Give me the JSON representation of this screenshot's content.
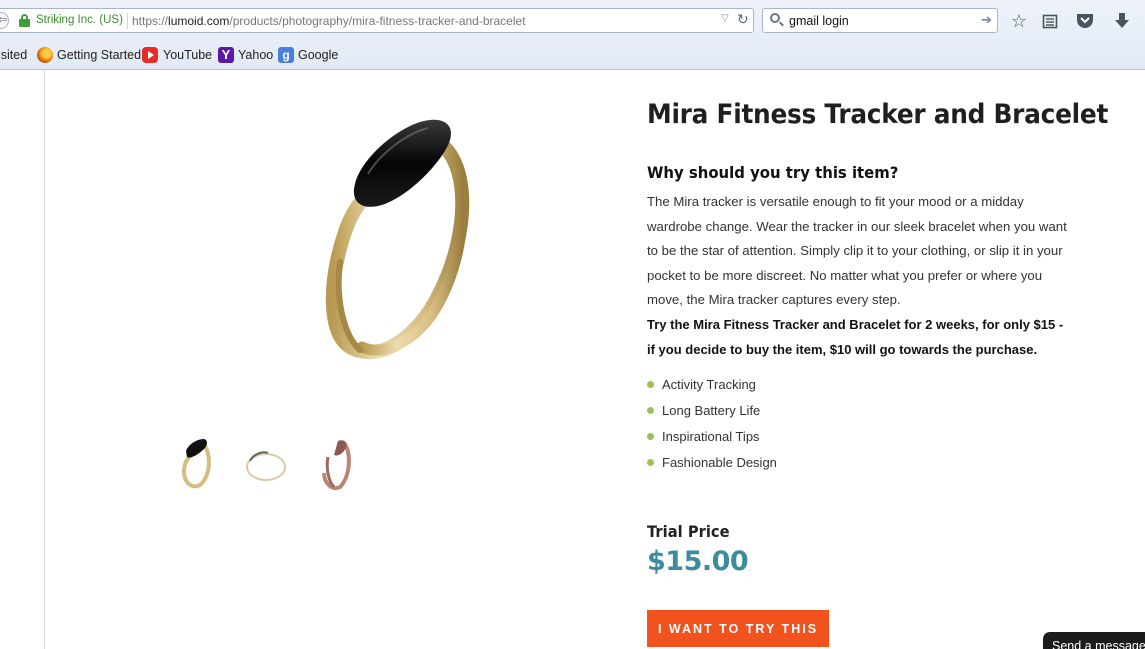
{
  "browser": {
    "identity": "Striking Inc. (US)",
    "url_prefix": "https://",
    "url_domain": "lumoid.com",
    "url_path": "/products/photography/mira-fitness-tracker-and-bracelet",
    "search_value": "gmail login",
    "bookmarks": [
      {
        "label": "Visited",
        "icon": "none"
      },
      {
        "label": "Getting Started",
        "icon": "firefox-icon"
      },
      {
        "label": "YouTube",
        "icon": "youtube-icon"
      },
      {
        "label": "Yahoo",
        "icon": "yahoo-icon"
      },
      {
        "label": "Google",
        "icon": "google-icon"
      }
    ],
    "bookmark_visited_partial": "isited",
    "yahoo_glyph": "Y",
    "google_glyph": "g"
  },
  "product": {
    "title": "Mira Fitness Tracker and Bracelet",
    "why_heading": "Why should you try this item?",
    "description": "The Mira tracker is versatile enough to fit your mood or a midday wardrobe change. Wear the tracker in our sleek bracelet when you want to be the star of attention. Simply clip it to your clothing, or slip it in your pocket to be more discreet. No matter what you prefer or where you move, the Mira tracker captures every step.",
    "offer": "Try the Mira Fitness Tracker and Bracelet for 2 weeks, for only $15 - if you decide to buy the item, $10 will go towards the purchase.",
    "features": [
      "Activity Tracking",
      "Long Battery Life",
      "Inspirational Tips",
      "Fashionable Design"
    ],
    "trial_label": "Trial Price",
    "price": "$15.00",
    "cta_label": "I WANT TO TRY THIS"
  },
  "chat": {
    "label": "Send a message"
  },
  "colors": {
    "accent_orange": "#f2531e",
    "price_teal": "#3b8c9e",
    "bullet_green": "#9cc254",
    "secure_green": "#3a8f2e"
  }
}
